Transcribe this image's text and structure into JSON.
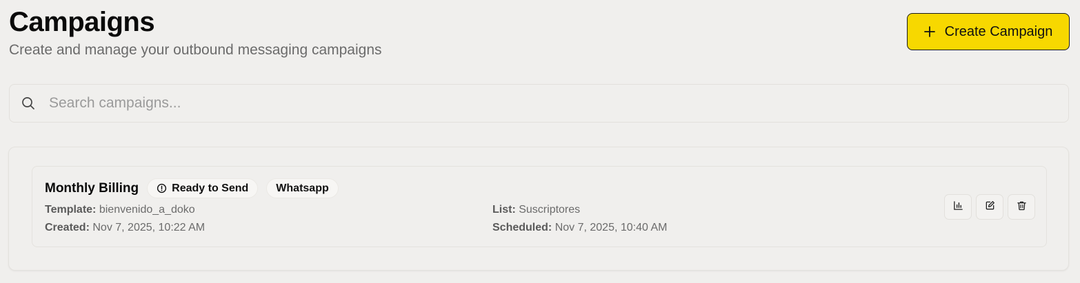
{
  "header": {
    "title": "Campaigns",
    "subtitle": "Create and manage your outbound messaging campaigns",
    "create_button_label": "Create Campaign"
  },
  "search": {
    "placeholder": "Search campaigns...",
    "value": ""
  },
  "campaigns": [
    {
      "name": "Monthly Billing",
      "status": "Ready to Send",
      "channel": "Whatsapp",
      "template_label": "Template:",
      "template": "bienvenido_a_doko",
      "created_label": "Created:",
      "created": "Nov 7, 2025, 10:22 AM",
      "list_label": "List:",
      "list": "Suscriptores",
      "scheduled_label": "Scheduled:",
      "scheduled": "Nov 7, 2025, 10:40 AM",
      "actions": [
        "bar-chart-icon",
        "edit-icon",
        "trash-icon"
      ]
    }
  ],
  "colors": {
    "background": "#f0efed",
    "accent": "#f7d800",
    "text_primary": "#0a0a0a",
    "text_secondary": "#6b6b6b"
  }
}
